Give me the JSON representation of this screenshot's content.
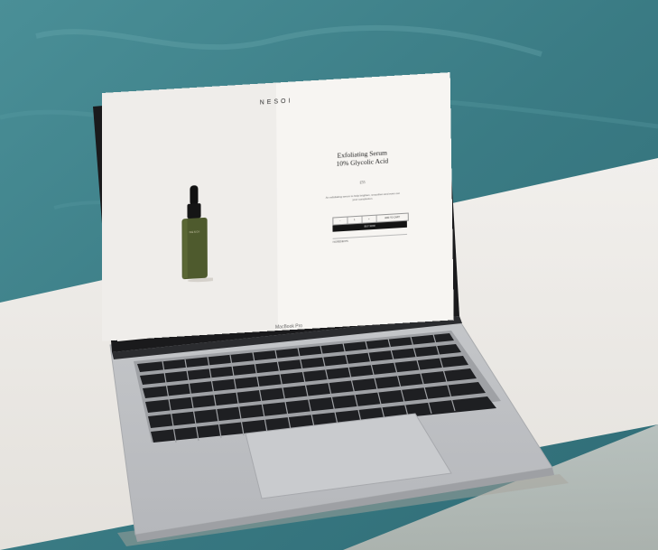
{
  "brand": "NESOI",
  "product": {
    "title_line1": "Exfoliating Serum",
    "title_line2": "10% Glycolic Acid",
    "price": "£55",
    "description": "An exfoliating serum to help brighten, smoothen and even out your complexion.",
    "bottle_label": "NESOI",
    "quantity_minus": "−",
    "quantity_value": "1",
    "quantity_plus": "+",
    "add_to_cart": "ADD TO CART",
    "buy_now": "BUY NOW",
    "ingredients_label": "INGREDIENTS"
  },
  "device": {
    "model": "MacBook Pro"
  },
  "colors": {
    "pool_water": "#3c7d86",
    "stone_ledge": "#e9e7e3",
    "laptop_silver": "#c8c9cb",
    "bottle_green": "#4e5a2d"
  }
}
